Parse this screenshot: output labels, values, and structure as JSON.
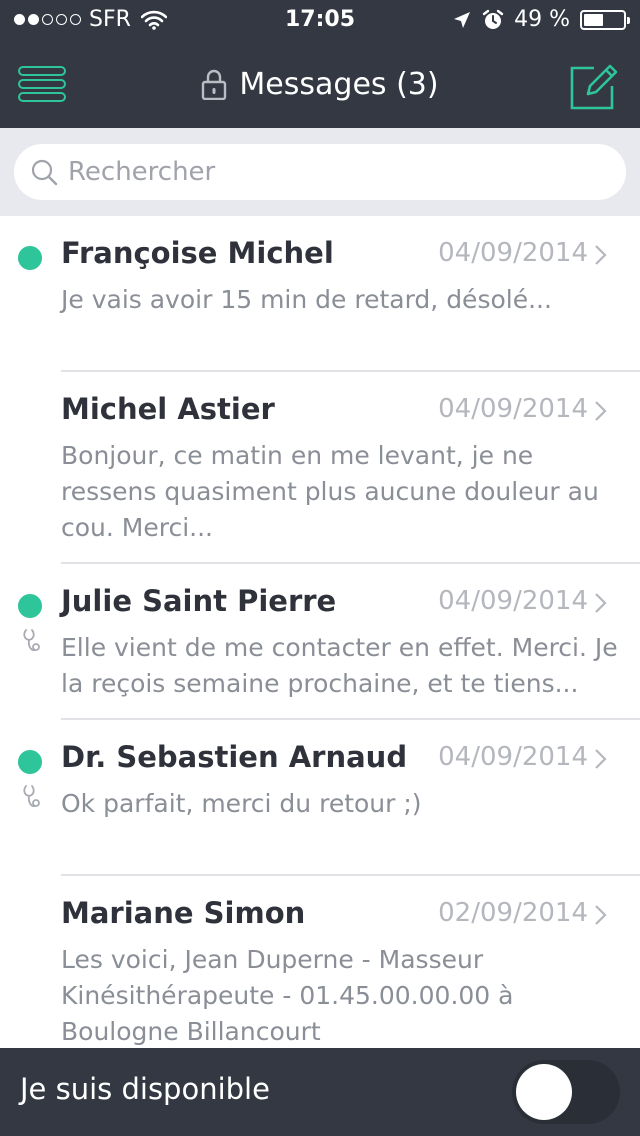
{
  "status_bar": {
    "carrier": "SFR",
    "time": "17:05",
    "battery": "49 %",
    "battery_level": 0.49,
    "signal_dots": [
      true,
      true,
      false,
      false,
      false
    ]
  },
  "header": {
    "title": "Messages (3)",
    "accent_color": "#2ec59a",
    "background_color": "#333843"
  },
  "search": {
    "placeholder": "Rechercher",
    "value": ""
  },
  "messages": [
    {
      "name": "Françoise Michel",
      "date": "04/09/2014",
      "preview": "Je vais avoir 15 min de retard, désolé...",
      "unread": true,
      "stethoscope": false
    },
    {
      "name": "Michel Astier",
      "date": "04/09/2014",
      "preview": "Bonjour, ce matin en me levant, je ne ressens quasiment plus aucune douleur au cou. Merci...",
      "unread": false,
      "stethoscope": false
    },
    {
      "name": "Julie Saint Pierre",
      "date": "04/09/2014",
      "preview": "Elle vient de me contacter en effet. Merci. Je la reçois semaine prochaine, et te tiens...",
      "unread": true,
      "stethoscope": true
    },
    {
      "name": "Dr. Sebastien Arnaud",
      "date": "04/09/2014",
      "preview": "Ok parfait, merci du retour ;)",
      "unread": true,
      "stethoscope": true
    },
    {
      "name": "Mariane Simon",
      "date": "02/09/2014",
      "preview": "Les voici, Jean Duperne - Masseur Kinésithérapeute - 01.45.00.00.00 à Boulogne Billancourt",
      "unread": false,
      "stethoscope": false
    }
  ],
  "footer": {
    "availability_label": "Je suis disponible",
    "available": false
  }
}
